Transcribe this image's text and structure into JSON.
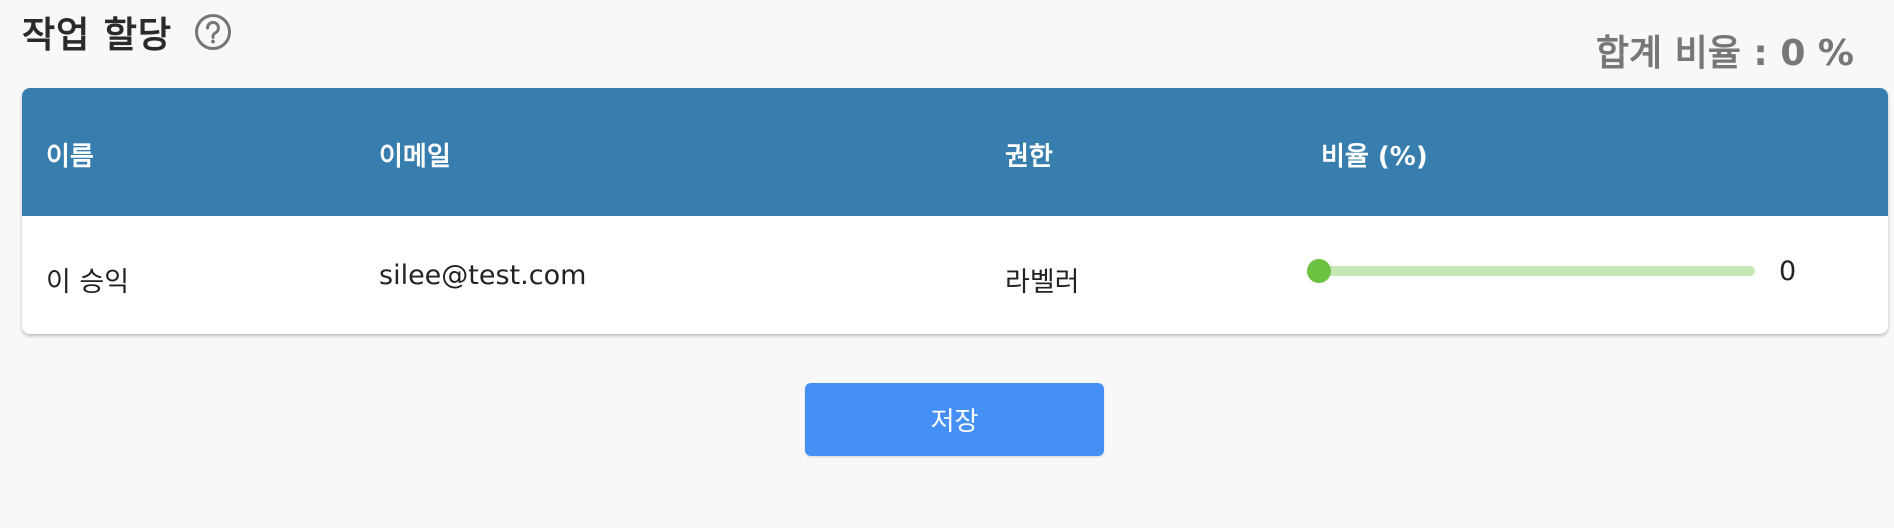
{
  "page": {
    "title": "작업 할당",
    "total_ratio": "합계 비율 : 0 %"
  },
  "icons": {
    "help": "help-circle-icon"
  },
  "table": {
    "columns": [
      "이름",
      "이메일",
      "권한",
      "비율 (%)"
    ],
    "rows": [
      {
        "name": "이 승익",
        "email": "silee@test.com",
        "role": "라벨러",
        "ratio": 0,
        "ratio_label": "0"
      }
    ]
  },
  "actions": {
    "save_label": "저장"
  },
  "colors": {
    "table_header": "#377eaf",
    "slider_thumb": "#6cc142",
    "slider_track": "#c6e6b3",
    "save_button": "#4590f5"
  }
}
